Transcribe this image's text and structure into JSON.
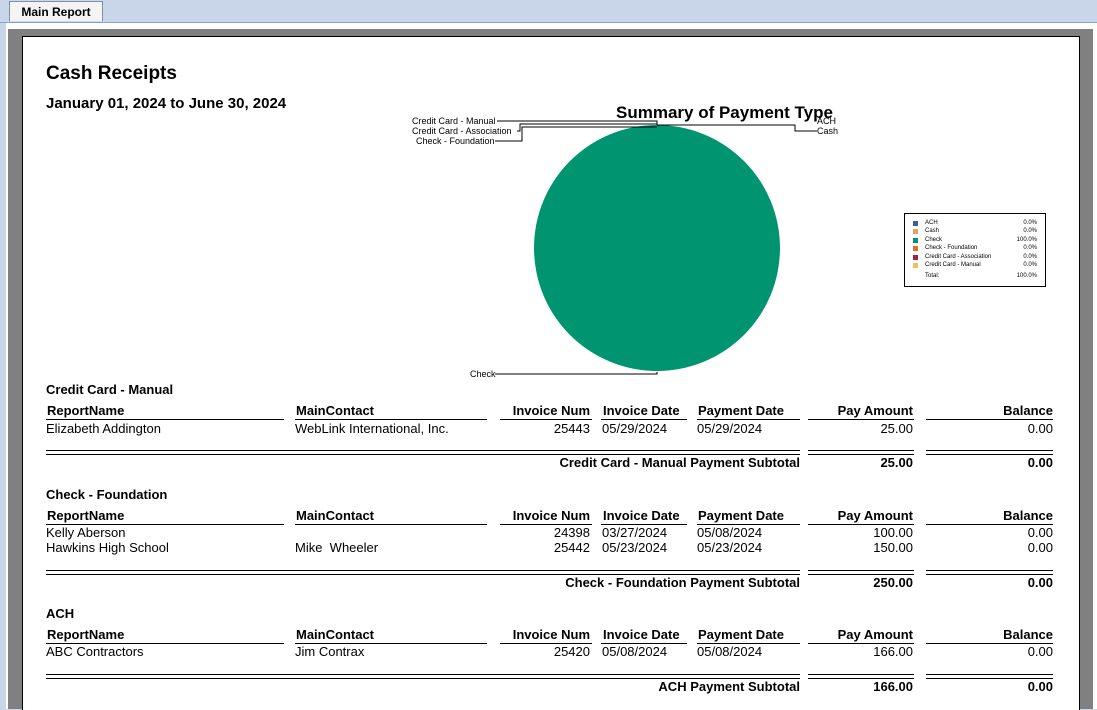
{
  "tab": {
    "label": "Main Report"
  },
  "report": {
    "title": "Cash Receipts",
    "date_range": "January 01, 2024 to June 30, 2024"
  },
  "chart_data": {
    "type": "pie",
    "title": "Summary of Payment Type",
    "categories": [
      "ACH",
      "Cash",
      "Check",
      "Check - Foundation",
      "Credit Card - Association",
      "Credit Card - Manual"
    ],
    "values": [
      0.0,
      0.0,
      100.0,
      0.0,
      0.0,
      0.0
    ],
    "colors": [
      "#3b5ea8",
      "#e8a060",
      "#009570",
      "#e07020",
      "#a02050",
      "#f0c060"
    ],
    "legend": {
      "placement": "right",
      "rows": [
        {
          "label": "ACH",
          "pct": "0.0%"
        },
        {
          "label": "Cash",
          "pct": "0.0%"
        },
        {
          "label": "Check",
          "pct": "100.0%"
        },
        {
          "label": "Check - Foundation",
          "pct": "0.0%"
        },
        {
          "label": "Credit Card - Association",
          "pct": "0.0%"
        },
        {
          "label": "Credit Card - Manual",
          "pct": "0.0%"
        }
      ],
      "total_label": "Total:",
      "total_pct": "100.0%"
    },
    "callouts": {
      "credit_card_manual": "Credit Card - Manual",
      "credit_card_association": "Credit Card - Association",
      "check_foundation": "Check - Foundation",
      "ach": "ACH",
      "cash": "Cash",
      "check": "Check"
    }
  },
  "columns": {
    "report_name": "ReportName",
    "main_contact": "MainContact",
    "invoice_num": "Invoice Num",
    "invoice_date": "Invoice Date",
    "payment_date": "Payment Date",
    "pay_amount": "Pay Amount",
    "balance": "Balance"
  },
  "sections": [
    {
      "name": "Credit Card - Manual",
      "rows": [
        {
          "report_name": "Elizabeth Addington",
          "main_contact": "WebLink International, Inc.",
          "invoice_num": "25443",
          "invoice_date": "05/29/2024",
          "payment_date": "05/29/2024",
          "pay_amount": "25.00",
          "balance": "0.00"
        }
      ],
      "subtotal_label": "Credit Card - Manual Payment Subtotal",
      "subtotal_amount": "25.00",
      "subtotal_balance": "0.00"
    },
    {
      "name": "Check - Foundation",
      "rows": [
        {
          "report_name": "Kelly Aberson",
          "main_contact": "",
          "invoice_num": "24398",
          "invoice_date": "03/27/2024",
          "payment_date": "05/08/2024",
          "pay_amount": "100.00",
          "balance": "0.00"
        },
        {
          "report_name": "Hawkins High School",
          "main_contact": "Mike  Wheeler",
          "invoice_num": "25442",
          "invoice_date": "05/23/2024",
          "payment_date": "05/23/2024",
          "pay_amount": "150.00",
          "balance": "0.00"
        }
      ],
      "subtotal_label": "Check - Foundation Payment Subtotal",
      "subtotal_amount": "250.00",
      "subtotal_balance": "0.00"
    },
    {
      "name": "ACH",
      "rows": [
        {
          "report_name": "ABC Contractors",
          "main_contact": "Jim Contrax",
          "invoice_num": "25420",
          "invoice_date": "05/08/2024",
          "payment_date": "05/08/2024",
          "pay_amount": "166.00",
          "balance": "0.00"
        }
      ],
      "subtotal_label": "ACH Payment Subtotal",
      "subtotal_amount": "166.00",
      "subtotal_balance": "0.00"
    }
  ]
}
